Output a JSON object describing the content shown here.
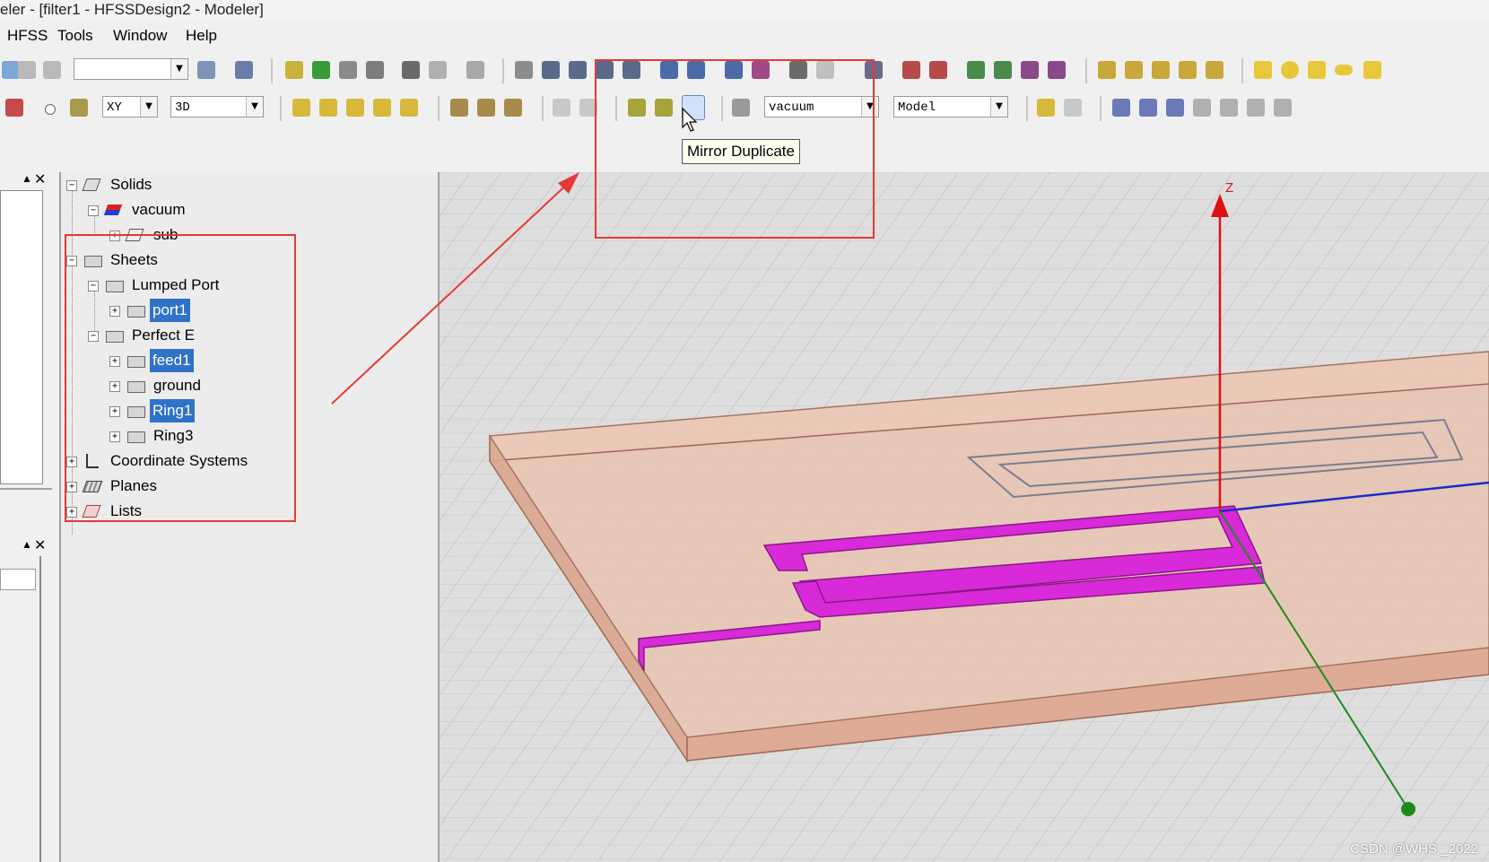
{
  "window": {
    "title": "eler - [filter1 - HFSSDesign2 - Modeler]"
  },
  "menubar": {
    "items": [
      "HFSS",
      "Tools",
      "Window",
      "Help"
    ]
  },
  "toolbar2": {
    "plane_combo": "XY",
    "view_combo": "3D",
    "material_combo": "vacuum",
    "model_combo": "Model"
  },
  "tooltip": {
    "text": "Mirror Duplicate"
  },
  "tree": {
    "solids": "Solids",
    "vacuum": "vacuum",
    "sub": "sub",
    "sheets": "Sheets",
    "lumped_port": "Lumped Port",
    "port1": "port1",
    "perfect_e": "Perfect E",
    "feed1": "feed1",
    "ground": "ground",
    "ring1": "Ring1",
    "ring3": "Ring3",
    "coordinate_systems": "Coordinate Systems",
    "planes": "Planes",
    "lists": "Lists"
  },
  "viewport": {
    "axis_z": "Z"
  },
  "watermark": "CSDN @WHS _2022",
  "colors": {
    "selection": "#3072c9",
    "highlight_box": "#e53935",
    "ring_trace": "#d82ad8",
    "substrate": "#e8bca8",
    "z_axis": "#e01010",
    "y_axis": "#1e8a1e",
    "x_axis": "#1a2cc8"
  }
}
